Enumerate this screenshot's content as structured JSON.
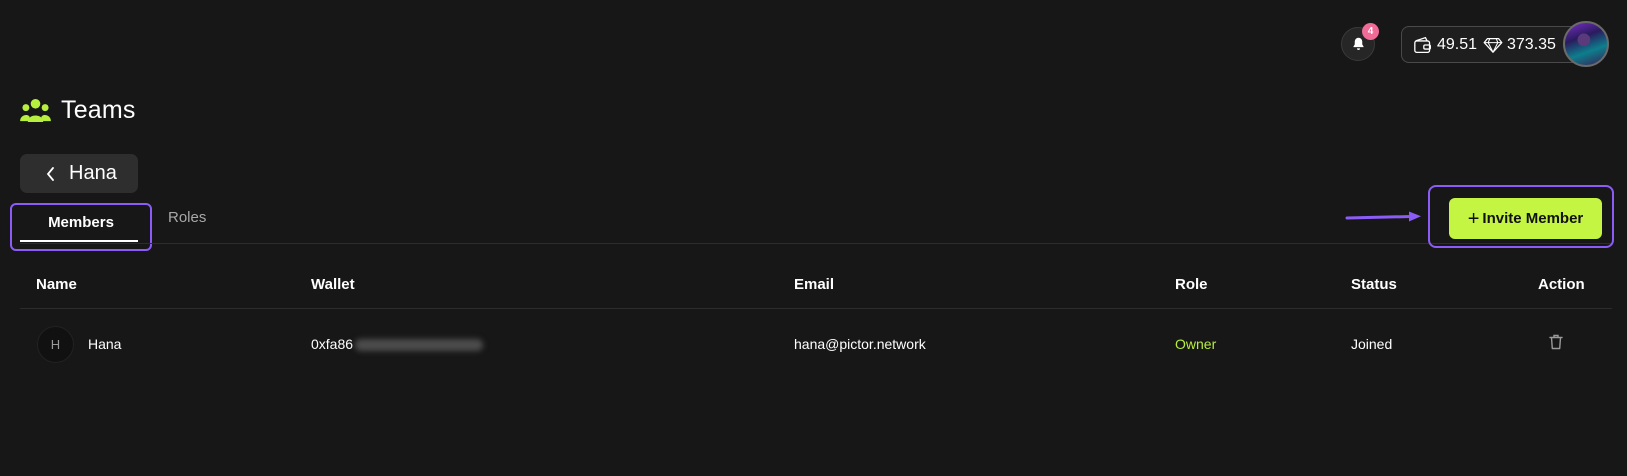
{
  "header": {
    "notifications": {
      "icon": "bell-icon",
      "count": "4"
    },
    "balance": {
      "wallet_icon": "wallet-icon",
      "wallet_amount": "49.51",
      "gem_icon": "diamond-icon",
      "gem_amount": "373.35"
    },
    "avatar": "user-avatar"
  },
  "page": {
    "icon": "users-icon",
    "title": "Teams"
  },
  "team": {
    "back_icon": "chevron-left-icon",
    "name": "Hana"
  },
  "tabs": [
    {
      "label": "Members",
      "active": true
    },
    {
      "label": "Roles",
      "active": false
    }
  ],
  "actions": {
    "invite_label": "Invite Member",
    "invite_icon": "plus-icon"
  },
  "table": {
    "columns": [
      "Name",
      "Wallet",
      "Email",
      "Role",
      "Status",
      "Action"
    ],
    "rows": [
      {
        "avatar_initial": "H",
        "name": "Hana",
        "wallet_visible": "0xfa86",
        "email": "hana@pictor.network",
        "role": "Owner",
        "status": "Joined",
        "action_icon": "trash-icon"
      }
    ]
  },
  "colors": {
    "background": "#171717",
    "accent_green": "#c4f542",
    "highlight_purple": "#8b5cf6",
    "badge_pink": "#f06b96"
  }
}
